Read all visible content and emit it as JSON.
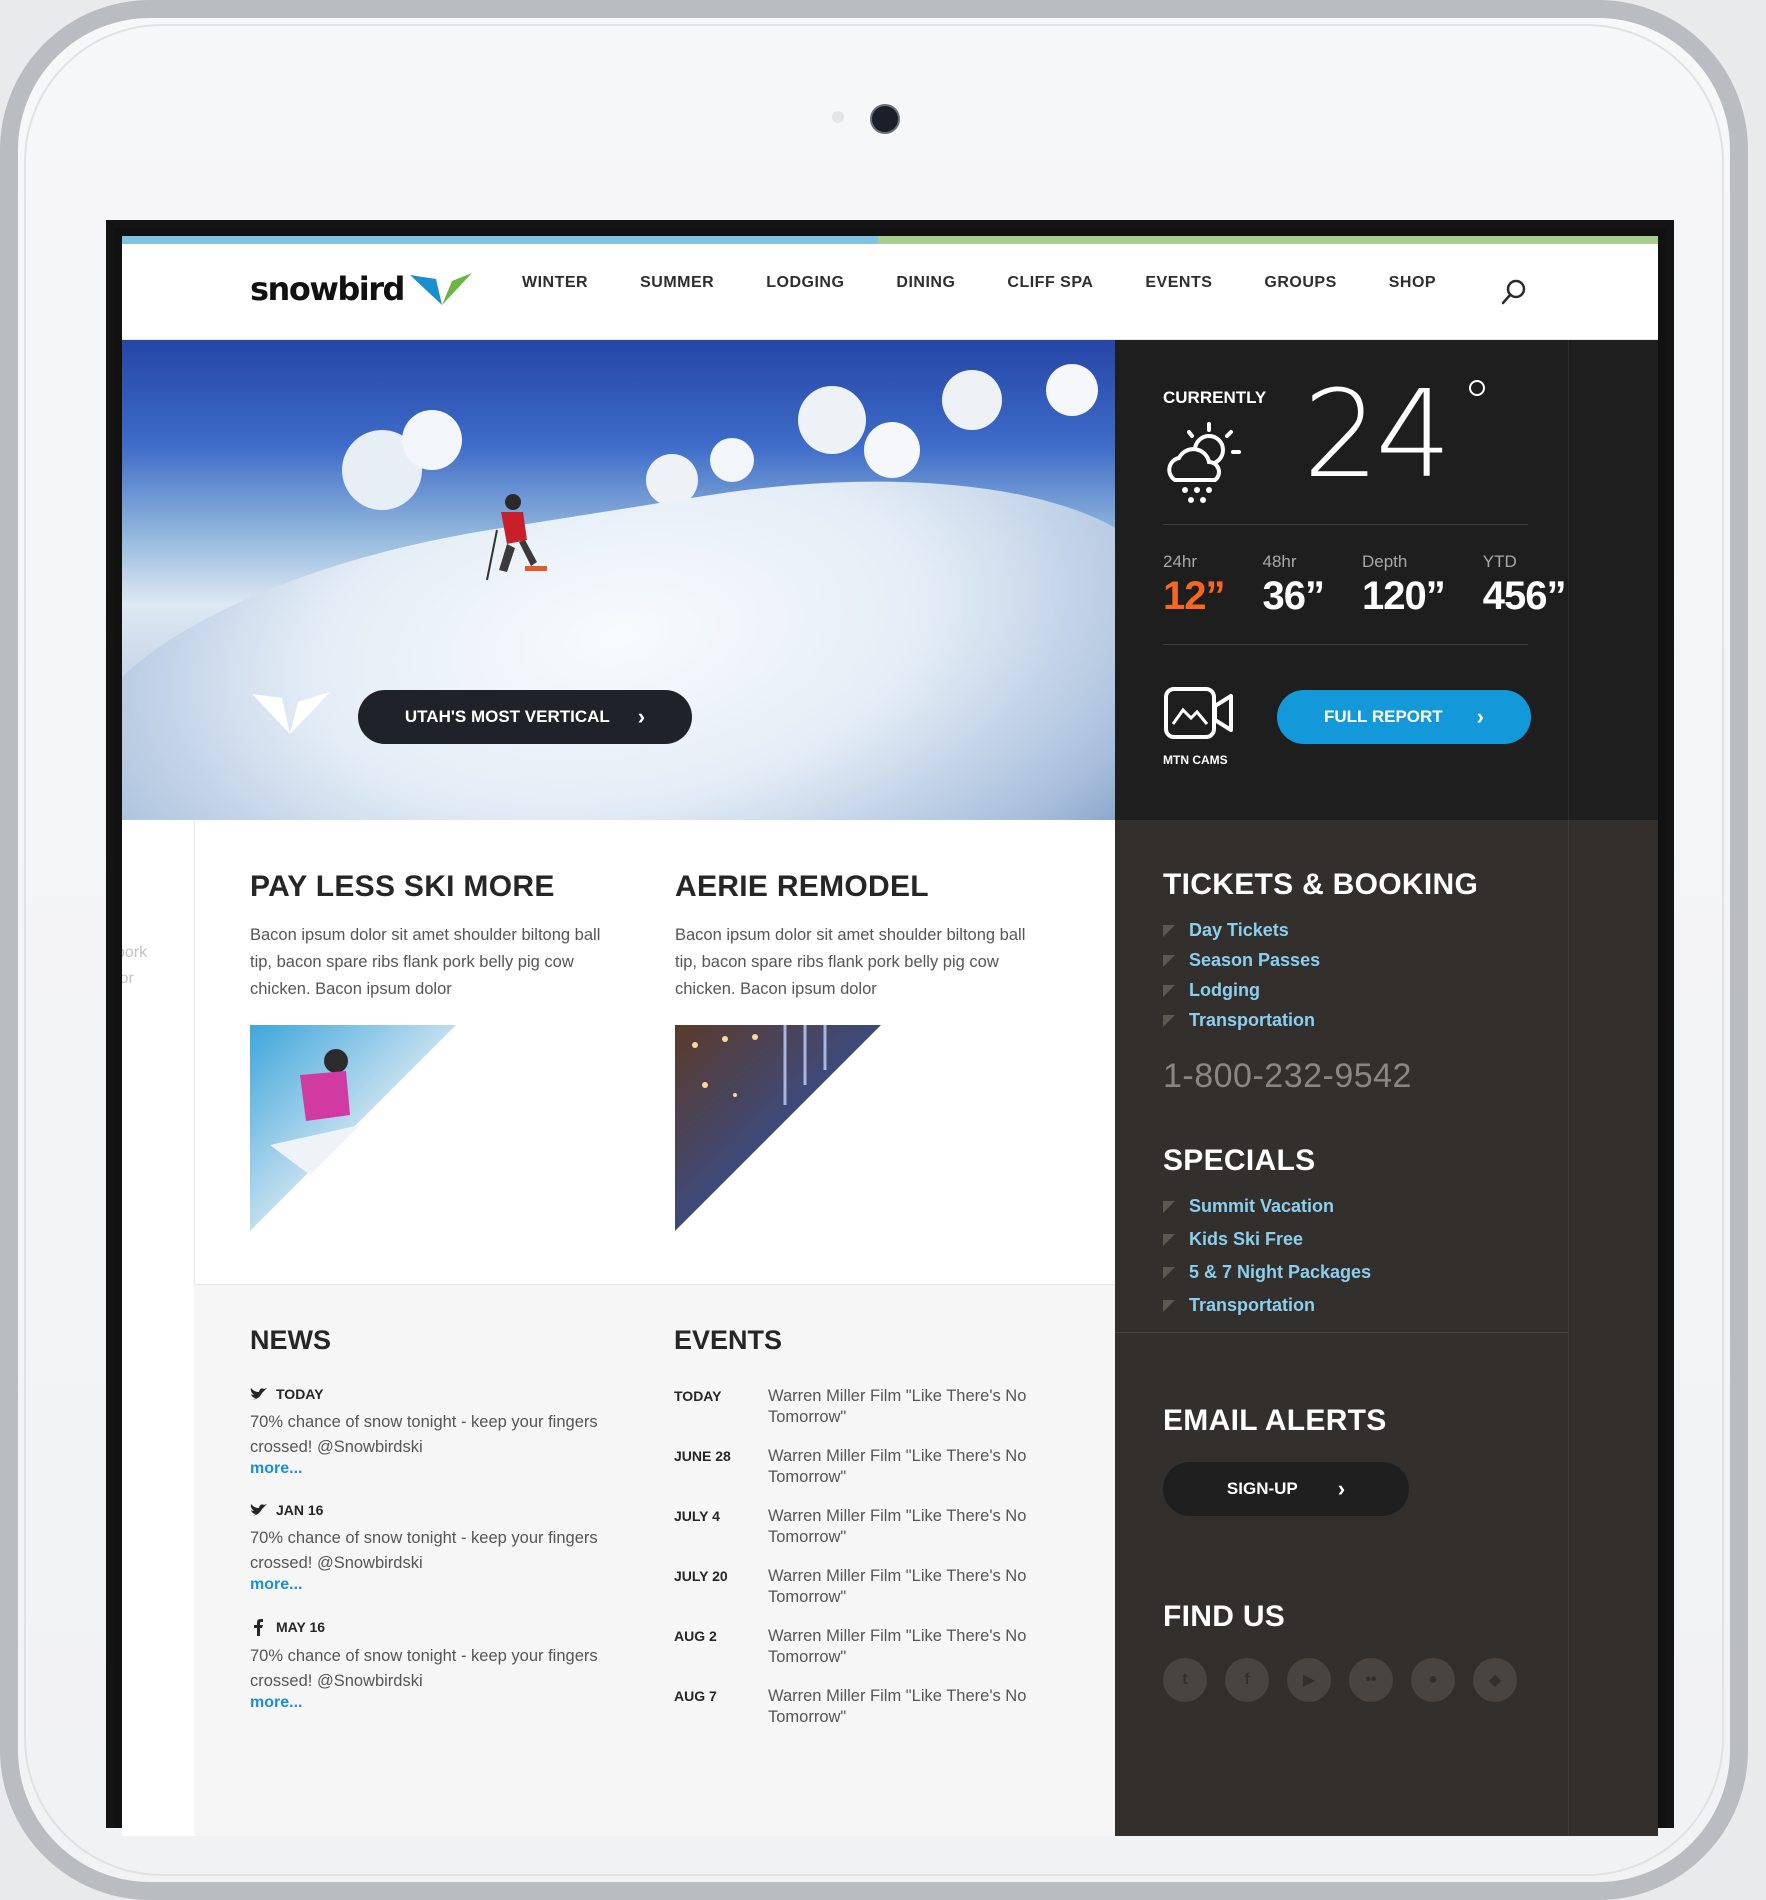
{
  "brand": {
    "name": "snowbird"
  },
  "colors": {
    "accent_blue": "#1398d9",
    "link_blue": "#8bcfee",
    "hot_orange": "#f4691f",
    "bar_blue": "#7ec3e3",
    "bar_green": "#a6cf8b"
  },
  "nav": {
    "items": [
      "WINTER",
      "SUMMER",
      "LODGING",
      "DINING",
      "CLIFF SPA",
      "EVENTS",
      "GROUPS",
      "SHOP"
    ],
    "search_icon": "search-icon"
  },
  "hero": {
    "button_label": "UTAH'S MOST VERTICAL"
  },
  "weather": {
    "label": "CURRENTLY",
    "temperature": "24",
    "icon": "partly-cloudy-snow-icon",
    "stats": [
      {
        "label": "24hr",
        "value": "12”"
      },
      {
        "label": "48hr",
        "value": "36”"
      },
      {
        "label": "Depth",
        "value": "120”"
      },
      {
        "label": "YTD",
        "value": "456”"
      }
    ],
    "cam_label": "MTN CAMS",
    "report_label": "FULL REPORT"
  },
  "left_strip": [
    "pork",
    "lor"
  ],
  "features": [
    {
      "title": "PAY LESS SKI MORE",
      "body": "Bacon ipsum dolor sit amet shoulder biltong ball tip, bacon spare ribs flank pork belly pig cow chicken. Bacon ipsum dolor"
    },
    {
      "title": "AERIE REMODEL",
      "body": "Bacon ipsum dolor sit amet shoulder biltong ball tip, bacon spare ribs flank pork belly pig cow chicken. Bacon ipsum dolor"
    }
  ],
  "news": {
    "title": "NEWS",
    "items": [
      {
        "source": "twitter-icon",
        "date": "TODAY",
        "text": "70% chance of snow tonight - keep your fingers crossed! @Snowbirdski",
        "more": "more..."
      },
      {
        "source": "twitter-icon",
        "date": "JAN 16",
        "text": "70% chance of snow tonight - keep your fingers crossed! @Snowbirdski",
        "more": "more..."
      },
      {
        "source": "facebook-icon",
        "date": "MAY 16",
        "text": "70% chance of snow tonight - keep your fingers crossed! @Snowbirdski",
        "more": "more..."
      }
    ]
  },
  "events": {
    "title": "EVENTS",
    "items": [
      {
        "date": "TODAY",
        "text": "Warren Miller Film \"Like There's No Tomorrow\""
      },
      {
        "date": "JUNE 28",
        "text": "Warren Miller Film \"Like There's No Tomorrow\""
      },
      {
        "date": "JULY 4",
        "text": "Warren Miller Film \"Like There's No Tomorrow\""
      },
      {
        "date": "JULY 20",
        "text": "Warren Miller Film \"Like There's No Tomorrow\""
      },
      {
        "date": "AUG 2",
        "text": "Warren Miller Film \"Like There's No Tomorrow\""
      },
      {
        "date": "AUG 7",
        "text": "Warren Miller Film \"Like There's No Tomorrow\""
      }
    ]
  },
  "sidebar": {
    "tickets": {
      "title": "TICKETS & BOOKING",
      "links": [
        "Day Tickets",
        "Season Passes",
        "Lodging",
        "Transportation"
      ],
      "phone": "1-800-232-9542"
    },
    "specials": {
      "title": "SPECIALS",
      "links": [
        "Summit Vacation",
        "Kids Ski Free",
        "5 & 7 Night Packages",
        "Transportation"
      ]
    },
    "email": {
      "title": "EMAIL ALERTS",
      "button_label": "SIGN-UP"
    },
    "find_us": {
      "title": "FIND US",
      "icons": [
        "twitter-icon",
        "facebook-icon",
        "youtube-icon",
        "flickr-icon",
        "apple-icon",
        "android-icon"
      ]
    }
  }
}
